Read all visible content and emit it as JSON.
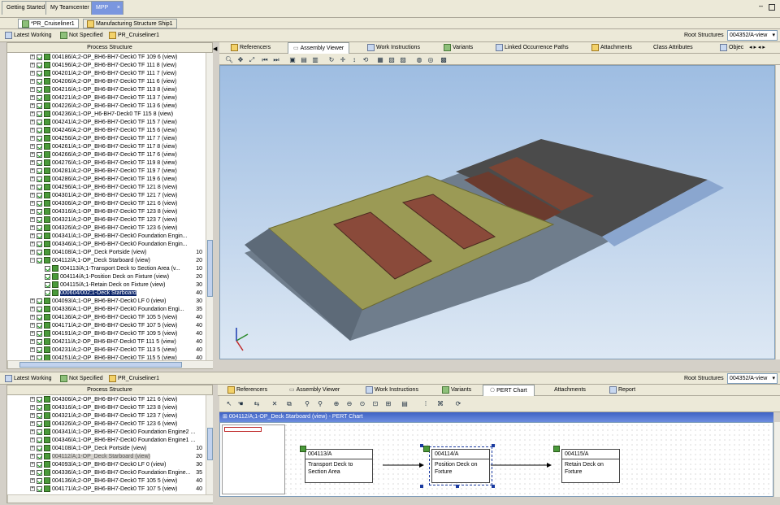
{
  "top_tabs": {
    "items": [
      {
        "label": "Getting Started"
      },
      {
        "label": "My Teamcenter"
      },
      {
        "label": "MPP"
      }
    ],
    "close": "×"
  },
  "doc_tabs": [
    {
      "label": "*PR_Cruiseliner1"
    },
    {
      "label": "Manufacturing Structure Ship1"
    }
  ],
  "context_bar": {
    "latest_working": "Latest Working",
    "not_specified": "Not Specified",
    "pr": "PR_Cruiseliner1",
    "root_label": "Root Structures",
    "root_value": "004352/A-view"
  },
  "process_structure": {
    "title": "Process Structure",
    "rows": [
      {
        "text": "004186/A;2-OP_BH6-BH7-Deck0 TF 109 6 (view)",
        "num": ""
      },
      {
        "text": "004196/A;2-OP_BH6-BH7-Deck0 TF 111 8 (view)",
        "num": ""
      },
      {
        "text": "004201/A;2-OP_BH6-BH7-Deck0 TF 111 7 (view)",
        "num": ""
      },
      {
        "text": "004206/A;2-OP_BH6-BH7-Deck0 TF 111 6 (view)",
        "num": ""
      },
      {
        "text": "004216/A;1-OP_BH6-BH7-Deck0 TF 113 8 (view)",
        "num": ""
      },
      {
        "text": "004221/A;2-OP_BH6-BH7-Deck0 TF 113 7 (view)",
        "num": ""
      },
      {
        "text": "004226/A;2-OP_BH6-BH7-Deck0 TF 113 6 (view)",
        "num": ""
      },
      {
        "text": "004236/A;1-OP_H6-BH7-Deck0 TF 115 8 (view)",
        "num": ""
      },
      {
        "text": "004241/A;2-OP_BH6-BH7-Deck0 TF 115 7 (view)",
        "num": ""
      },
      {
        "text": "004246/A;2-OP_BH6-BH7-Deck0 TF 115 6 (view)",
        "num": ""
      },
      {
        "text": "004256/A;2-OP_BH6-BH7-Deck0 TF 117 7 (view)",
        "num": ""
      },
      {
        "text": "004261/A;1-OP_BH6-BH7-Deck0 TF 117 8 (view)",
        "num": ""
      },
      {
        "text": "004266/A;2-OP_BH6-BH7-Deck0 TF 117 6 (view)",
        "num": ""
      },
      {
        "text": "004276/A;1-OP_BH6-BH7-Deck0 TF 119 8 (view)",
        "num": ""
      },
      {
        "text": "004281/A;2-OP_BH6-BH7-Deck0 TF 119 7 (view)",
        "num": ""
      },
      {
        "text": "004286/A;2-OP_BH6-BH7-Deck0 TF 119 6 (view)",
        "num": ""
      },
      {
        "text": "004296/A;1-OP_BH6-BH7-Deck0 TF 121 8 (view)",
        "num": ""
      },
      {
        "text": "004301/A;2-OP_BH6-BH7-Deck0 TF 121 7 (view)",
        "num": ""
      },
      {
        "text": "004306/A;2-OP_BH6-BH7-Deck0 TF 121 6 (view)",
        "num": ""
      },
      {
        "text": "004316/A;1-OP_BH6-BH7-Deck0 TF 123 8 (view)",
        "num": ""
      },
      {
        "text": "004321/A;2-OP_BH6-BH7-Deck0 TF 123 7 (view)",
        "num": ""
      },
      {
        "text": "004326/A;2-OP_BH6-BH7-Deck0 TF 123 6 (view)",
        "num": ""
      },
      {
        "text": "004341/A;1-OP_BH6-BH7-Deck0 Foundation Engin...",
        "num": ""
      },
      {
        "text": "004346/A;1-OP_BH6-BH7-Deck0 Foundation Engin...",
        "num": ""
      },
      {
        "text": "004108/A;1-OP_Deck Portside (view)",
        "num": "10"
      },
      {
        "text": "004112/A;1-OP_Deck Starboard (view)",
        "num": "20"
      },
      {
        "text": "004113/A;1-Transport Deck to Section Area (v...",
        "num": "10"
      },
      {
        "text": "004114/A;1-Position Deck on Fixture (view)",
        "num": "20"
      },
      {
        "text": "004115/A;1-Retain Deck on Fixture (view)",
        "num": "30"
      },
      {
        "text": "000604/002;1-Deck Starboard",
        "num": "40"
      },
      {
        "text": "004093/A;1-OP_BH6-BH7-Deck0 LF 0 (view)",
        "num": "30"
      },
      {
        "text": "004336/A;1-OP_BH6-BH7-Deck0 Foundation Engi...",
        "num": "35"
      },
      {
        "text": "004136/A;2-OP_BH6-BH7-Deck0 TF 105 5 (view)",
        "num": "40"
      },
      {
        "text": "004171/A;2-OP_BH6-BH7-Deck0 TF 107 5 (view)",
        "num": "40"
      },
      {
        "text": "004191/A;2-OP_BH6-BH7-Deck0 TF 109 5 (view)",
        "num": "40"
      },
      {
        "text": "004211/A;2-OP_BH6-BH7-Deck0 TF 111 5 (view)",
        "num": "40"
      },
      {
        "text": "004231/A;2-OP_BH6-BH7-Deck0 TF 113 5 (view)",
        "num": "40"
      },
      {
        "text": "004251/A;2-OP_BH6-BH7-Deck0 TF 115 5 (view)",
        "num": "40"
      }
    ]
  },
  "viewer_tabs": [
    {
      "label": "Referencers"
    },
    {
      "label": "Assembly Viewer"
    },
    {
      "label": "Work Instructions"
    },
    {
      "label": "Variants"
    },
    {
      "label": "Linked Occurrence Paths"
    },
    {
      "label": "Attachments"
    },
    {
      "label": "Class Attributes"
    },
    {
      "label": "Objec"
    }
  ],
  "bottom_context": {
    "latest_working": "Latest Working",
    "not_specified": "Not Specified",
    "pr": "PR_Cruiseliner1",
    "root_label": "Root Structures",
    "root_value": "004352/A-view"
  },
  "bottom_tree": {
    "title": "Process Structure",
    "rows": [
      {
        "text": "004306/A;2-OP_BH6-BH7-Deck0 TF 121 6 (view)",
        "num": ""
      },
      {
        "text": "004316/A;1-OP_BH6-BH7-Deck0 TF 123 8 (view)",
        "num": ""
      },
      {
        "text": "004321/A;2-OP_BH6-BH7-Deck0 TF 123 7 (view)",
        "num": ""
      },
      {
        "text": "004326/A;2-OP_BH6-BH7-Deck0 TF 123 6 (view)",
        "num": ""
      },
      {
        "text": "004341/A;1-OP_BH6-BH7-Deck0 Foundation Engine2 ...",
        "num": ""
      },
      {
        "text": "004346/A;1-OP_BH6-BH7-Deck0 Foundation Engine1 ...",
        "num": ""
      },
      {
        "text": "004108/A;1-OP_Deck Portside (view)",
        "num": "10"
      },
      {
        "text": "004112/A;1-OP_Deck Starboard (view)",
        "num": "20"
      },
      {
        "text": "004093/A;1-OP_BH6-BH7-Deck0 LF 0 (view)",
        "num": "30"
      },
      {
        "text": "004336/A;1-OP_BH6-BH7-Deck0 Foundation Engine...",
        "num": "35"
      },
      {
        "text": "004136/A;2-OP_BH6-BH7-Deck0 TF 105 5 (view)",
        "num": "40"
      },
      {
        "text": "004171/A;2-OP_BH6-BH7-Deck0 TF 107 5 (view)",
        "num": "40"
      }
    ]
  },
  "bottom_tabs": [
    {
      "label": "Referencers"
    },
    {
      "label": "Assembly Viewer"
    },
    {
      "label": "Work Instructions"
    },
    {
      "label": "Variants"
    },
    {
      "label": "PERT Chart"
    },
    {
      "label": "Attachments"
    },
    {
      "label": "Report"
    }
  ],
  "pert": {
    "title": "004112/A;1-OP_Deck Starboard (view) - PERT Chart",
    "nodes": [
      {
        "id": "004113/A",
        "desc": "Transport Deck to Section Area"
      },
      {
        "id": "004114/A",
        "desc": "Position Deck on Fixture"
      },
      {
        "id": "004115/A",
        "desc": "Retain Deck on Fixture"
      }
    ]
  },
  "colors": {
    "selection": "#0a246a",
    "viewer_top": "#9ebde2",
    "viewer_bottom": "#dde8f4",
    "deck": "#9b9a55",
    "hull": "#4b4b4b",
    "fixture": "#8a4a3a"
  }
}
